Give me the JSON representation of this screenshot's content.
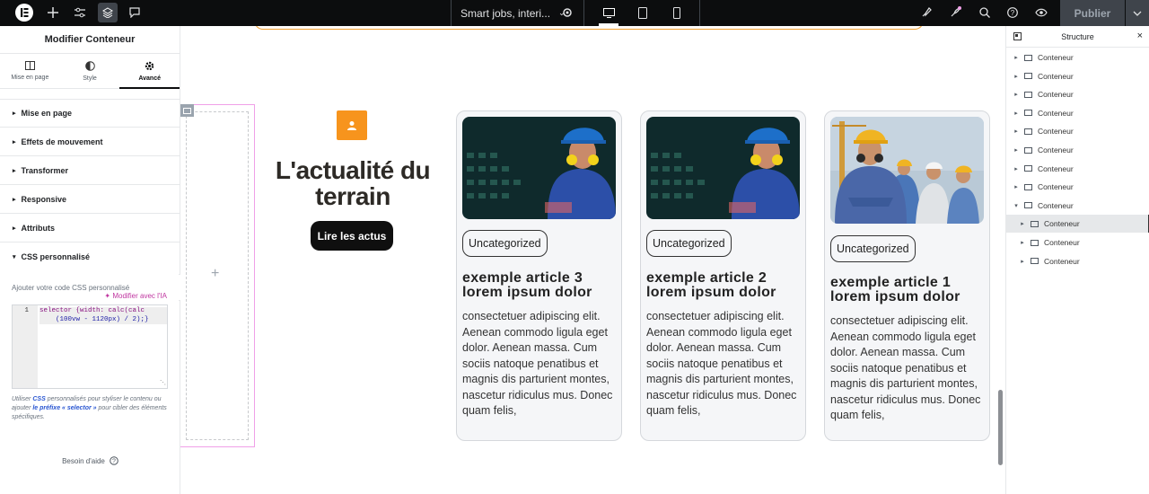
{
  "topbar": {
    "document_title": "Smart jobs, interi...",
    "publish_label": "Publier"
  },
  "left_panel": {
    "title": "Modifier Conteneur",
    "tabs": [
      {
        "label": "Mise en page",
        "icon": "layout-icon"
      },
      {
        "label": "Style",
        "icon": "half-circle-icon"
      },
      {
        "label": "Avancé",
        "icon": "gear-icon",
        "active": true
      }
    ],
    "sections": [
      {
        "label": "Mise en page",
        "expanded": false
      },
      {
        "label": "Effets de mouvement",
        "expanded": false
      },
      {
        "label": "Transformer",
        "expanded": false
      },
      {
        "label": "Responsive",
        "expanded": false
      },
      {
        "label": "Attributs",
        "expanded": false
      },
      {
        "label": "CSS personnalisé",
        "expanded": true
      }
    ],
    "css_help": "Ajouter votre code CSS personnalisé",
    "ai_link": "Modifier avec l'IA",
    "code_line_number": "1",
    "code_line_1": "selector {width: calc(calc",
    "code_line_2": "(100vw - 1120px) / 2);}",
    "css_note_prefix": "Utiliser ",
    "css_note_css": "CSS",
    "css_note_mid": " personnalisés pour styliser le contenu ou ajouter ",
    "css_note_link": "le préfixe « selector »",
    "css_note_suffix": " pour cibler des éléments spécifiques.",
    "help_label": "Besoin d'aide"
  },
  "canvas": {
    "headline": "L'actualité du terrain",
    "cta_label": "Lire les actus",
    "cards": [
      {
        "category": "Uncategorized",
        "title": "exemple article 3 lorem ipsum dolor",
        "body": "consectetuer adipiscing elit. Aenean commodo ligula eget dolor. Aenean massa. Cum sociis natoque penatibus et magnis dis parturient montes, nascetur ridiculus mus. Donec quam felis,"
      },
      {
        "category": "Uncategorized",
        "title": "exemple article 2 lorem ipsum dolor",
        "body": "consectetuer adipiscing elit. Aenean commodo ligula eget dolor. Aenean massa. Cum sociis natoque penatibus et magnis dis parturient montes, nascetur ridiculus mus. Donec quam felis,"
      },
      {
        "category": "Uncategorized",
        "title": "exemple article 1 lorem ipsum dolor",
        "body": "consectetuer adipiscing elit. Aenean commodo ligula eget dolor. Aenean massa. Cum sociis natoque penatibus et magnis dis parturient montes, nascetur ridiculus mus. Donec quam felis,"
      }
    ]
  },
  "structure": {
    "title": "Structure",
    "nodes": [
      {
        "label": "Conteneur",
        "depth": 0,
        "expanded": false
      },
      {
        "label": "Conteneur",
        "depth": 0,
        "expanded": false
      },
      {
        "label": "Conteneur",
        "depth": 0,
        "expanded": false
      },
      {
        "label": "Conteneur",
        "depth": 0,
        "expanded": false
      },
      {
        "label": "Conteneur",
        "depth": 0,
        "expanded": false
      },
      {
        "label": "Conteneur",
        "depth": 0,
        "expanded": false
      },
      {
        "label": "Conteneur",
        "depth": 0,
        "expanded": false
      },
      {
        "label": "Conteneur",
        "depth": 0,
        "expanded": false
      },
      {
        "label": "Conteneur",
        "depth": 0,
        "expanded": true
      },
      {
        "label": "Conteneur",
        "depth": 1,
        "expanded": false,
        "selected": true
      },
      {
        "label": "Conteneur",
        "depth": 1,
        "expanded": false
      },
      {
        "label": "Conteneur",
        "depth": 1,
        "expanded": false
      }
    ]
  },
  "colors": {
    "accent_orange": "#f7941d",
    "editor_pink": "#c036a0",
    "topbar": "#0c0d0e"
  }
}
